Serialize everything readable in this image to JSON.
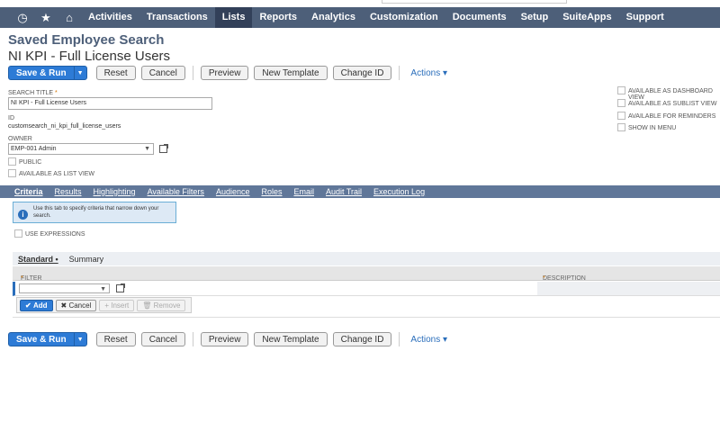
{
  "nav": {
    "items": [
      "Activities",
      "Transactions",
      "Lists",
      "Reports",
      "Analytics",
      "Customization",
      "Documents",
      "Setup",
      "SuiteApps",
      "Support"
    ],
    "active": "Lists"
  },
  "page": {
    "title": "Saved Employee Search",
    "subtitle": "NI KPI - Full License Users"
  },
  "toolbar": {
    "save_run": "Save & Run",
    "reset": "Reset",
    "cancel": "Cancel",
    "preview": "Preview",
    "new_template": "New Template",
    "change_id": "Change ID",
    "actions": "Actions"
  },
  "form": {
    "search_title_label": "SEARCH TITLE",
    "search_title_value": "NI KPI - Full License Users",
    "id_label": "ID",
    "id_value": "customsearch_ni_kpi_full_license_users",
    "owner_label": "OWNER",
    "owner_value": "EMP-001 Admin",
    "public_label": "PUBLIC",
    "list_view_label": "AVAILABLE AS LIST VIEW"
  },
  "right_checkboxes": [
    "AVAILABLE AS DASHBOARD VIEW",
    "AVAILABLE AS SUBLIST VIEW",
    "AVAILABLE FOR REMINDERS",
    "SHOW IN MENU"
  ],
  "tabs": [
    "Criteria",
    "Results",
    "Highlighting",
    "Available Filters",
    "Audience",
    "Roles",
    "Email",
    "Audit Trail",
    "Execution Log"
  ],
  "tip": "Use this tab to specify criteria that narrow down your search.",
  "use_expressions": "USE EXPRESSIONS",
  "subtabs": [
    "Standard",
    "Summary"
  ],
  "grid": {
    "filter_header": "FILTER",
    "description_header": "DESCRIPTION",
    "add": "Add",
    "cancel": "Cancel",
    "insert": "Insert",
    "remove": "Remove"
  },
  "colors": {
    "nav_bg": "#4d5f79",
    "tab_bg": "#607799",
    "primary": "#2d7bd6",
    "link": "#2a6ebb"
  }
}
